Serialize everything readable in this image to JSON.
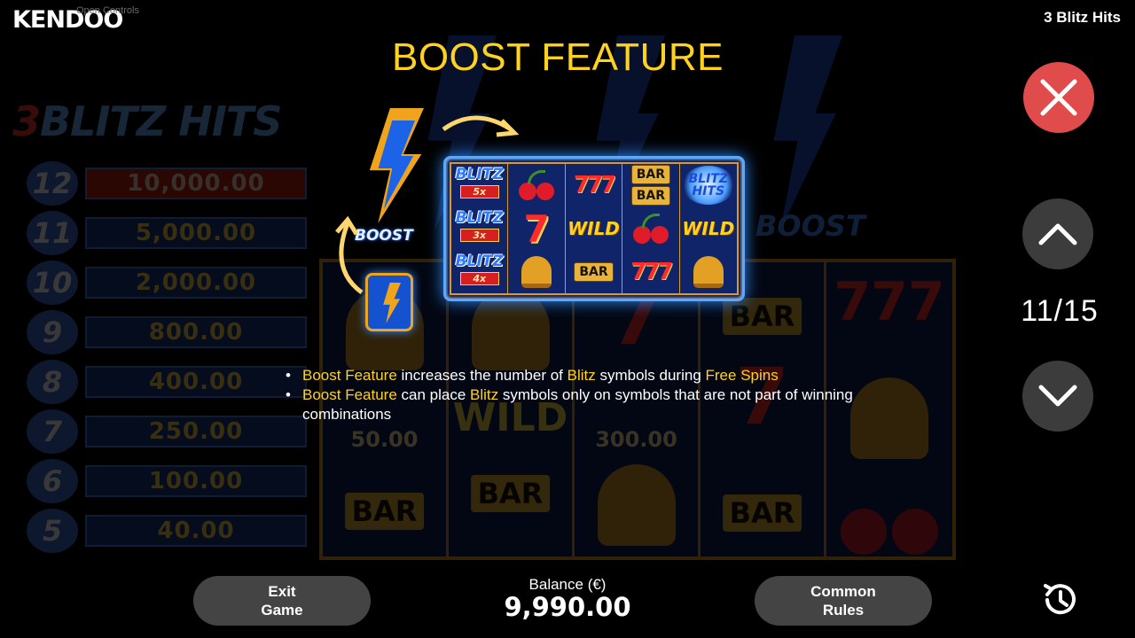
{
  "header": {
    "brand": "KENDOO",
    "open_controls": "Open Controls",
    "game_title": "3 Blitz Hits"
  },
  "background": {
    "logo_prefix": "3",
    "logo_rest": "BLITZ HITS",
    "boost_label": "BOOST",
    "paytable": [
      {
        "count": "12",
        "amount": "10,000.00"
      },
      {
        "count": "11",
        "amount": "5,000.00"
      },
      {
        "count": "10",
        "amount": "2,000.00"
      },
      {
        "count": "9",
        "amount": "800.00"
      },
      {
        "count": "8",
        "amount": "400.00"
      },
      {
        "count": "7",
        "amount": "250.00"
      },
      {
        "count": "6",
        "amount": "100.00"
      },
      {
        "count": "5",
        "amount": "40.00"
      }
    ],
    "reel_amounts": [
      "50.00",
      "300.00"
    ],
    "bar_label": "BAR",
    "wild_label": "WILD"
  },
  "help": {
    "title": "BOOST FEATURE",
    "boost_tag": "BOOST",
    "grid": {
      "blitz_label": "BLITZ",
      "multipliers": [
        "5x",
        "3x",
        "4x"
      ],
      "bar_label": "BAR",
      "wild_label": "WILD",
      "hit_label_1": "BLITZ",
      "hit_label_2": "HITS",
      "seven": "7",
      "sevens": "777"
    },
    "rules": [
      {
        "parts": [
          "Boost Feature",
          " increases the number of ",
          "Blitz",
          " symbols during ",
          "Free Spins"
        ]
      },
      {
        "parts": [
          "Boost Feature",
          " can place ",
          "Blitz",
          " symbols only on symbols that are not part of winning combinations"
        ]
      }
    ]
  },
  "navigation": {
    "page_counter": "11/15",
    "close_icon": "close-icon",
    "up_icon": "chevron-up-icon",
    "down_icon": "chevron-down-icon"
  },
  "footer": {
    "exit_label": "Exit\nGame",
    "balance_label": "Balance (€)",
    "balance_value": "9,990.00",
    "common_rules_label": "Common\nRules",
    "history_icon": "history-icon"
  },
  "colors": {
    "accent_yellow": "#ffd21f",
    "close_red": "#e04b4b",
    "button_grey": "#444444"
  }
}
